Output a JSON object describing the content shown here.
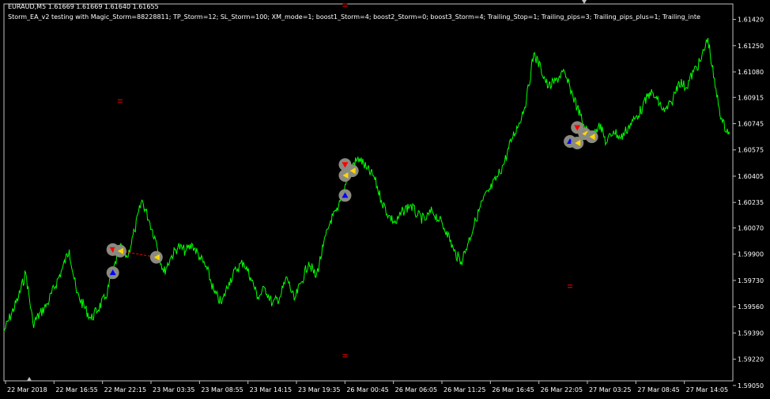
{
  "header": {
    "symbol_quote": "EURAUD,M5  1.61669 1.61669 1.61640 1.61655",
    "ea_settings": "Storm_EA_v2 testing with Magic_Storm=88228811; TP_Storm=12; SL_Storm=100; XM_mode=1; boost1_Storm=4; boost2_Storm=0; boost3_Storm=4; Trailing_Stop=1; Trailing_pips=3; Trailing_pips_plus=1; Trailing_inte"
  },
  "colors": {
    "background": "#000000",
    "price_line": "#00ff00",
    "axis": "#c0c0c0",
    "text": "#ffffff",
    "buy_arrow": "#0000ff",
    "sell_arrow": "#ff0000",
    "close_marker": "#ffd700",
    "trade_line": "#ff0000"
  },
  "chart_data": {
    "type": "line",
    "grid": false,
    "ylim": [
      1.5908,
      1.6152
    ],
    "y_ticks": [
      "1.61420",
      "1.61250",
      "1.61080",
      "1.60915",
      "1.60745",
      "1.60575",
      "1.60405",
      "1.60235",
      "1.60070",
      "1.59900",
      "1.59730",
      "1.59560",
      "1.59390",
      "1.59220",
      "1.59050"
    ],
    "x_ticks": [
      "22 Mar 2018",
      "22 Mar 16:55",
      "22 Mar 22:15",
      "23 Mar 03:35",
      "23 Mar 08:55",
      "23 Mar 14:15",
      "23 Mar 19:35",
      "26 Mar 00:45",
      "26 Mar 06:05",
      "26 Mar 11:25",
      "26 Mar 16:45",
      "26 Mar 22:05",
      "27 Mar 03:25",
      "27 Mar 08:45",
      "27 Mar 14:05"
    ],
    "x_index_range": [
      0,
      100
    ],
    "series": [
      {
        "x": [
          0,
          2,
          3,
          4,
          6,
          8,
          9,
          10,
          12,
          14,
          15,
          16,
          17,
          18,
          19,
          20,
          21,
          22,
          23,
          24,
          25,
          26,
          27,
          28,
          29,
          30,
          31,
          32,
          33,
          34,
          35,
          36,
          37,
          38,
          39,
          40,
          41,
          42,
          43,
          44,
          45,
          46,
          47,
          48,
          49,
          50,
          51,
          52,
          53,
          54,
          55,
          56,
          57,
          58,
          59,
          60,
          61,
          62,
          63,
          64,
          65,
          66,
          67,
          68,
          69,
          70,
          71,
          72,
          73,
          74,
          75,
          76,
          77,
          78,
          79,
          80,
          81,
          82,
          83,
          84,
          85,
          86,
          87,
          88,
          89,
          90,
          91,
          92,
          93,
          94,
          95,
          96,
          97,
          98,
          99,
          100
        ],
        "values": [
          1.594,
          1.5962,
          1.5978,
          1.5945,
          1.5958,
          1.598,
          1.5993,
          1.5965,
          1.5948,
          1.5962,
          1.5978,
          1.5995,
          1.5988,
          1.6005,
          1.6025,
          1.6012,
          1.5998,
          1.5978,
          1.5988,
          1.5995,
          1.5992,
          1.5996,
          1.5988,
          1.598,
          1.5965,
          1.5958,
          1.5972,
          1.598,
          1.5985,
          1.5975,
          1.5962,
          1.5968,
          1.5958,
          1.5962,
          1.5975,
          1.596,
          1.5972,
          1.5985,
          1.5975,
          1.5995,
          1.6012,
          1.6018,
          1.6035,
          1.6048,
          1.6052,
          1.6045,
          1.604,
          1.6025,
          1.6015,
          1.601,
          1.6018,
          1.6022,
          1.6015,
          1.6012,
          1.6018,
          1.6012,
          1.6005,
          1.5992,
          1.5985,
          1.5998,
          1.6012,
          1.6025,
          1.6032,
          1.604,
          1.605,
          1.6065,
          1.6075,
          1.609,
          1.612,
          1.611,
          1.6098,
          1.6102,
          1.6108,
          1.6098,
          1.6085,
          1.6072,
          1.6065,
          1.6075,
          1.6062,
          1.607,
          1.6065,
          1.6072,
          1.6078,
          1.6085,
          1.6095,
          1.609,
          1.6082,
          1.6088,
          1.6102,
          1.6098,
          1.6108,
          1.6115,
          1.613,
          1.6098,
          1.6075,
          1.6068
        ],
        "color": "#00ff00"
      }
    ],
    "sell_marks": [
      {
        "x": 15,
        "y": 1.5993
      },
      {
        "x": 47,
        "y": 1.6048
      },
      {
        "x": 79,
        "y": 1.6072
      }
    ],
    "buy_marks": [
      {
        "x": 15,
        "y": 1.5978
      },
      {
        "x": 47,
        "y": 1.6028
      },
      {
        "x": 78,
        "y": 1.6063
      }
    ],
    "close_marks": [
      {
        "x": 16,
        "y": 1.5992
      },
      {
        "x": 21,
        "y": 1.5988
      },
      {
        "x": 48,
        "y": 1.6044
      },
      {
        "x": 47,
        "y": 1.6041
      },
      {
        "x": 80,
        "y": 1.6068
      },
      {
        "x": 81,
        "y": 1.6066
      },
      {
        "x": 79,
        "y": 1.6062
      }
    ],
    "trade_lines": [
      {
        "x1": 15,
        "y1": 1.5993,
        "x2": 21,
        "y2": 1.5988
      }
    ],
    "pending_marks": [
      {
        "x": 16,
        "y": 1.609
      },
      {
        "x": 47,
        "y": 1.6152
      },
      {
        "x": 47,
        "y": 1.5925
      },
      {
        "x": 78,
        "y": 1.597
      }
    ]
  }
}
